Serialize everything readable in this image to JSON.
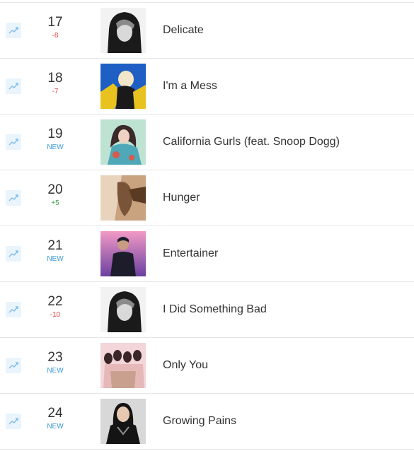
{
  "colors": {
    "down": "#e0493f",
    "up": "#3fa34d",
    "new": "#3b9ad9",
    "trend_icon": "#7fbde8",
    "trend_bg": "#eaf4fc"
  },
  "rows": [
    {
      "rank": "17",
      "change": "-8",
      "change_type": "down",
      "title": "Delicate",
      "cover": {
        "bg": "#f2f2f2",
        "a": "#1a1a1a",
        "b": "#8a8a8a",
        "c": "#d9d9d9"
      }
    },
    {
      "rank": "18",
      "change": "-7",
      "change_type": "down",
      "title": "I'm a Mess",
      "cover": {
        "bg": "#1f5fc4",
        "a": "#e8c21f",
        "b": "#f1e6c7",
        "c": "#1a1a1a"
      }
    },
    {
      "rank": "19",
      "change": "NEW",
      "change_type": "new",
      "title": "California Gurls (feat. Snoop Dogg)",
      "cover": {
        "bg": "#bfe3d3",
        "a": "#3a2a2a",
        "b": "#4fa8b8",
        "c": "#d95a4a"
      }
    },
    {
      "rank": "20",
      "change": "+5",
      "change_type": "up",
      "title": "Hunger",
      "cover": {
        "bg": "#c9a27f",
        "a": "#7a5438",
        "b": "#e8d4bd",
        "c": "#5a3a22"
      }
    },
    {
      "rank": "21",
      "change": "NEW",
      "change_type": "new",
      "title": "Entertainer",
      "cover": {
        "bg": "#d65ba6",
        "a": "#1c1c2a",
        "b": "#f29ac6",
        "c": "#6b3fa0"
      }
    },
    {
      "rank": "22",
      "change": "-10",
      "change_type": "down",
      "title": "I Did Something Bad",
      "cover": {
        "bg": "#f2f2f2",
        "a": "#1a1a1a",
        "b": "#8a8a8a",
        "c": "#d9d9d9"
      }
    },
    {
      "rank": "23",
      "change": "NEW",
      "change_type": "new",
      "title": "Only You",
      "cover": {
        "bg": "#f3d6da",
        "a": "#3a2626",
        "b": "#e6b9b9",
        "c": "#c9a08e"
      }
    },
    {
      "rank": "24",
      "change": "NEW",
      "change_type": "new",
      "title": "Growing Pains",
      "cover": {
        "bg": "#d8d8d8",
        "a": "#141414",
        "b": "#8f8f8f",
        "c": "#e6c9b0"
      }
    }
  ]
}
